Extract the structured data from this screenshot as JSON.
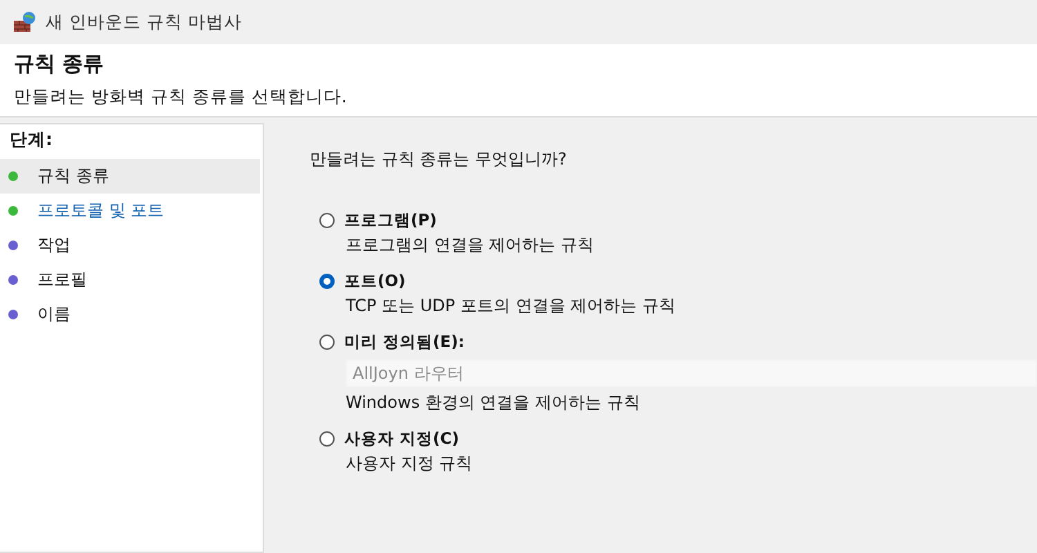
{
  "window": {
    "title": "새 인바운드 규칙 마법사"
  },
  "header": {
    "title": "규칙 종류",
    "subtitle": "만들려는 방화벽 규칙 종류를 선택합니다."
  },
  "steps": {
    "heading": "단계:",
    "items": [
      {
        "label": "규칙 종류",
        "selected": true,
        "link": false,
        "color": "#3cb83c"
      },
      {
        "label": "프로토콜 및 포트",
        "selected": false,
        "link": true,
        "color": "#3cb83c"
      },
      {
        "label": "작업",
        "selected": false,
        "link": false,
        "color": "#6a5fd0"
      },
      {
        "label": "프로필",
        "selected": false,
        "link": false,
        "color": "#6a5fd0"
      },
      {
        "label": "이름",
        "selected": false,
        "link": false,
        "color": "#6a5fd0"
      }
    ]
  },
  "main": {
    "question": "만들려는 규칙 종류는 무엇입니까?",
    "options": [
      {
        "kind": "plain",
        "label": "프로그램(P)",
        "description": "프로그램의 연결을 제어하는 규칙",
        "selected": false
      },
      {
        "kind": "plain",
        "label": "포트(O)",
        "description": "TCP 또는 UDP 포트의 연결을 제어하는 규칙",
        "selected": true
      },
      {
        "kind": "dropdown",
        "label": "미리 정의됨(E):",
        "value": "AllJoyn 라우터",
        "disabled": true,
        "description": "Windows 환경의 연결을 제어하는 규칙",
        "selected": false
      },
      {
        "kind": "plain",
        "label": "사용자 지정(C)",
        "description": "사용자 지정 규칙",
        "selected": false
      }
    ]
  }
}
